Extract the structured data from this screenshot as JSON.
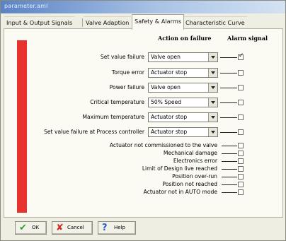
{
  "window": {
    "title": "parameter.aml"
  },
  "tabs": [
    {
      "label": "Input & Output Signals"
    },
    {
      "label": "Valve Adaption"
    },
    {
      "label": "Safety & Alarms",
      "active": true
    },
    {
      "label": "Characteristic Curve"
    }
  ],
  "headers": {
    "action": "Action on failure",
    "alarm": "Alarm signal"
  },
  "action_rows": [
    {
      "label": "Set value failure",
      "value": "Valve open",
      "alarm": true
    },
    {
      "label": "Torque error",
      "value": "Actuator stop",
      "alarm": false
    },
    {
      "label": "Power failure",
      "value": "Valve open",
      "alarm": false
    },
    {
      "label": "Critical temperature",
      "value": "50% Speed",
      "alarm": false
    },
    {
      "label": "Maximum temperature",
      "value": "Actuator stop",
      "alarm": false
    },
    {
      "label": "Set value failure at Process controller",
      "value": "Actuator stop",
      "alarm": false
    }
  ],
  "alarm_rows": [
    {
      "label": "Actuator not commissioned to the valve",
      "alarm": false
    },
    {
      "label": "Mechanical damage",
      "alarm": false
    },
    {
      "label": "Electronics error",
      "alarm": false
    },
    {
      "label": "Limit of Design live reached",
      "alarm": false
    },
    {
      "label": "Position over-run",
      "alarm": false
    },
    {
      "label": "Position not reached",
      "alarm": false
    },
    {
      "label": "Actuator not in AUTO mode",
      "alarm": false
    }
  ],
  "buttons": {
    "ok": {
      "label": "OK",
      "icon": "checkmark-icon"
    },
    "cancel": {
      "label": "Cancel",
      "icon": "cross-icon"
    },
    "help": {
      "label": "Help",
      "icon": "question-icon"
    }
  },
  "colors": {
    "status_bar": "#e8322e",
    "ok_icon": "#2e9e2e",
    "cancel_icon": "#d42a1f",
    "help_icon": "#2a5fd0"
  }
}
